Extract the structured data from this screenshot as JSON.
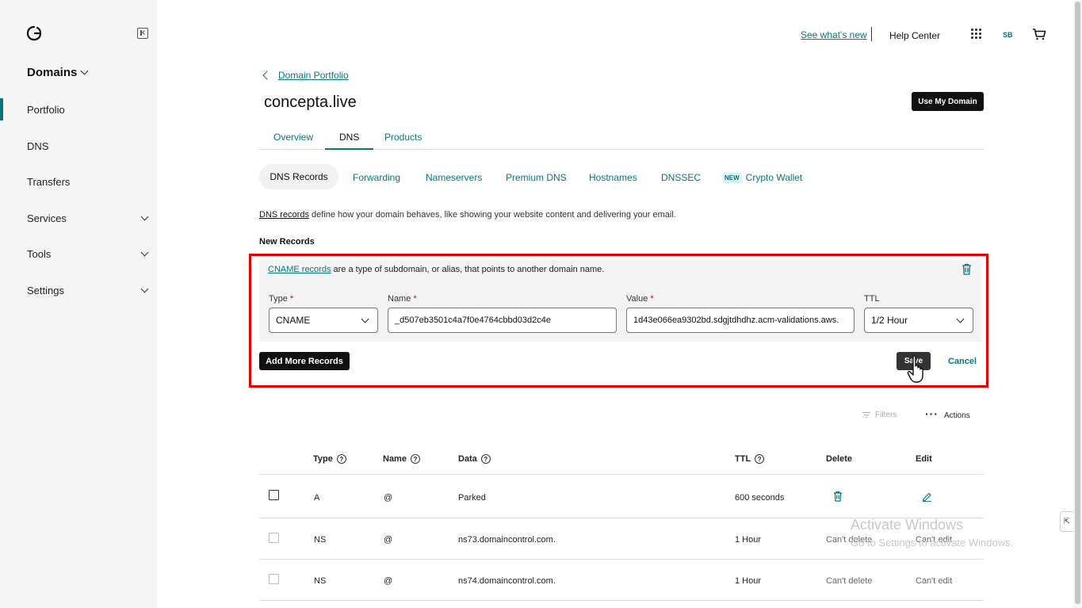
{
  "sidebar": {
    "section_title": "Domains",
    "items": [
      {
        "label": "Portfolio"
      },
      {
        "label": "DNS"
      },
      {
        "label": "Transfers"
      },
      {
        "label": "Services"
      },
      {
        "label": "Tools"
      },
      {
        "label": "Settings"
      }
    ]
  },
  "topbar": {
    "whats_new": "See what's new",
    "help": "Help Center",
    "avatar": "SB"
  },
  "breadcrumb": {
    "back_label": "Domain Portfolio"
  },
  "page": {
    "title": "concepta.live",
    "use_domain_button": "Use My Domain"
  },
  "tabs": [
    {
      "label": "Overview"
    },
    {
      "label": "DNS"
    },
    {
      "label": "Products"
    }
  ],
  "subtabs": [
    {
      "label": "DNS Records"
    },
    {
      "label": "Forwarding"
    },
    {
      "label": "Nameservers"
    },
    {
      "label": "Premium DNS"
    },
    {
      "label": "Hostnames"
    },
    {
      "label": "DNSSEC"
    },
    {
      "label": "Crypto Wallet",
      "badge": "NEW"
    }
  ],
  "description": {
    "link": "DNS records",
    "text": " define how your domain behaves, like showing your website content and delivering your email."
  },
  "new_records": {
    "title": "New Records",
    "cname_link": "CNAME records",
    "cname_text": " are a type of subdomain, or alias, that points to another domain name.",
    "fields": {
      "type_label": "Type",
      "type_value": "CNAME",
      "name_label": "Name",
      "name_value": "_d507eb3501c4a7f0e4764cbbd03d2c4e",
      "value_label": "Value",
      "value_value": "1d43e066ea9302bd.sdgjtdhdhz.acm-validations.aws.",
      "ttl_label": "TTL",
      "ttl_value": "1/2 Hour",
      "required_mark": "*"
    },
    "add_more_button": "Add More Records",
    "save_button": "Save",
    "cancel_button": "Cancel"
  },
  "toolbar": {
    "filters": "Filters",
    "actions": "Actions"
  },
  "table": {
    "headers": {
      "type": "Type",
      "name": "Name",
      "data": "Data",
      "ttl": "TTL",
      "delete": "Delete",
      "edit": "Edit"
    },
    "rows": [
      {
        "type": "A",
        "name": "@",
        "data": "Parked",
        "ttl": "600 seconds",
        "delete": "",
        "edit": ""
      },
      {
        "type": "NS",
        "name": "@",
        "data": "ns73.domaincontrol.com.",
        "ttl": "1 Hour",
        "delete": "Can't delete",
        "edit": "Can't edit"
      },
      {
        "type": "NS",
        "name": "@",
        "data": "ns74.domaincontrol.com.",
        "ttl": "1 Hour",
        "delete": "Can't delete",
        "edit": "Can't edit"
      }
    ]
  },
  "watermark": {
    "line1": "Activate Windows",
    "line2": "Go to Settings to activate Windows."
  },
  "colors": {
    "accent": "#09757a",
    "highlight": "#e00000",
    "sidebar_bg": "#f5f5f5"
  }
}
